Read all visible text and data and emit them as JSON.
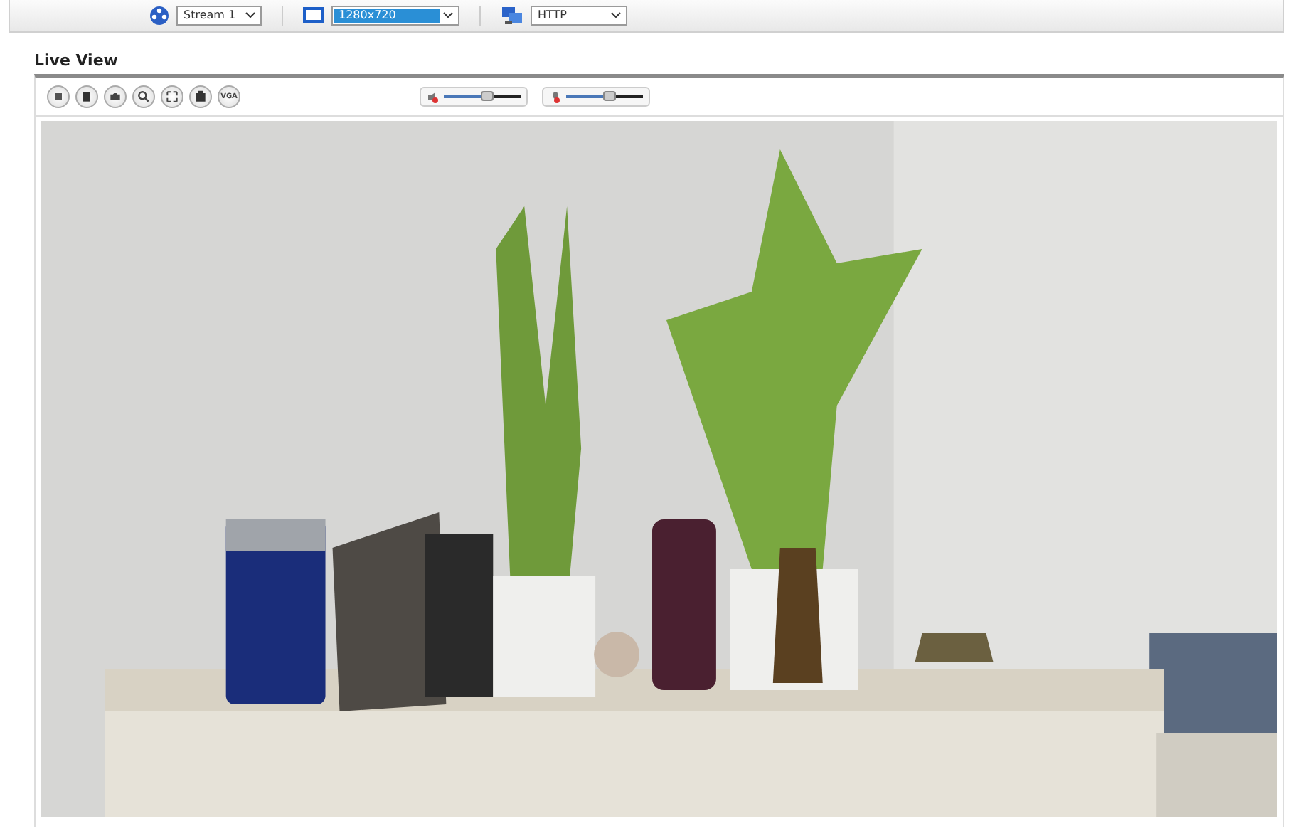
{
  "top_bar": {
    "stream": "Stream 1",
    "resolution": "1280x720",
    "protocol": "HTTP"
  },
  "section_title": "Live View",
  "toolbar": {
    "buttons": [
      {
        "kind": "icon"
      },
      {
        "kind": "icon"
      },
      {
        "kind": "icon"
      },
      {
        "kind": "icon"
      },
      {
        "kind": "icon"
      },
      {
        "kind": "icon"
      },
      {
        "kind": "text",
        "label": "VGA"
      }
    ],
    "sliders": [
      {
        "kind": "speaker",
        "level": 0.55
      },
      {
        "kind": "microphone",
        "level": 0.55
      }
    ]
  }
}
